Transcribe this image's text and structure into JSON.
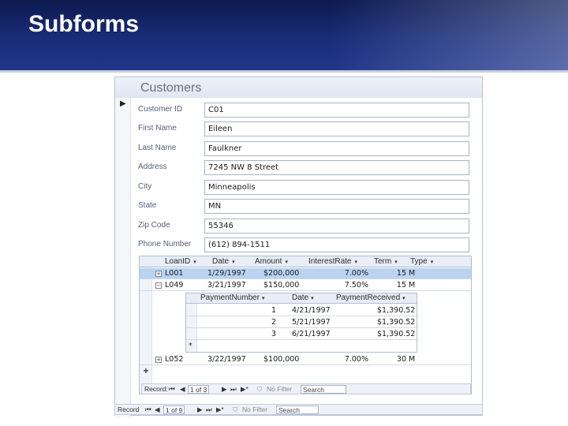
{
  "slide": {
    "title": "Subforms"
  },
  "form": {
    "title": "Customers",
    "fields": [
      {
        "label": "Customer ID",
        "value": "C01"
      },
      {
        "label": "First Name",
        "value": "Eileen"
      },
      {
        "label": "Last Name",
        "value": "Faulkner"
      },
      {
        "label": "Address",
        "value": "7245 NW 8 Street"
      },
      {
        "label": "City",
        "value": "Minneapolis"
      },
      {
        "label": "State",
        "value": "MN"
      },
      {
        "label": "Zip Code",
        "value": "55346"
      },
      {
        "label": "Phone Number",
        "value": "(612) 894-1511"
      }
    ]
  },
  "loans": {
    "headers": [
      "LoanID",
      "Date",
      "Amount",
      "InterestRate",
      "Term",
      "Type"
    ],
    "rows": [
      {
        "expander": "+",
        "loan_id": "L001",
        "date": "1/29/1997",
        "amount": "$200,000",
        "rate": "7.00%",
        "term": "15",
        "type": "M"
      },
      {
        "expander": "−",
        "loan_id": "L049",
        "date": "3/21/1997",
        "amount": "$150,000",
        "rate": "7.50%",
        "term": "15",
        "type": "M"
      },
      {
        "expander": "+",
        "loan_id": "L052",
        "date": "3/22/1997",
        "amount": "$100,000",
        "rate": "7.00%",
        "term": "30",
        "type": "M"
      }
    ],
    "new_row_marker": "+"
  },
  "payments": {
    "headers": [
      "PaymentNumber",
      "Date",
      "PaymentReceived"
    ],
    "rows": [
      {
        "number": "1",
        "date": "4/21/1997",
        "received": "$1,390.52"
      },
      {
        "number": "2",
        "date": "5/21/1997",
        "received": "$1,390.52"
      },
      {
        "number": "3",
        "date": "6/21/1997",
        "received": "$1,390.52"
      }
    ],
    "new_row_marker": "*"
  },
  "subform_nav": {
    "record_label": "Record:",
    "position": "1 of 3",
    "filter": "No Filter",
    "search": "Search"
  },
  "main_nav": {
    "record_label": "Record",
    "position": "1 of 9",
    "filter": "No Filter",
    "search": "Search"
  }
}
